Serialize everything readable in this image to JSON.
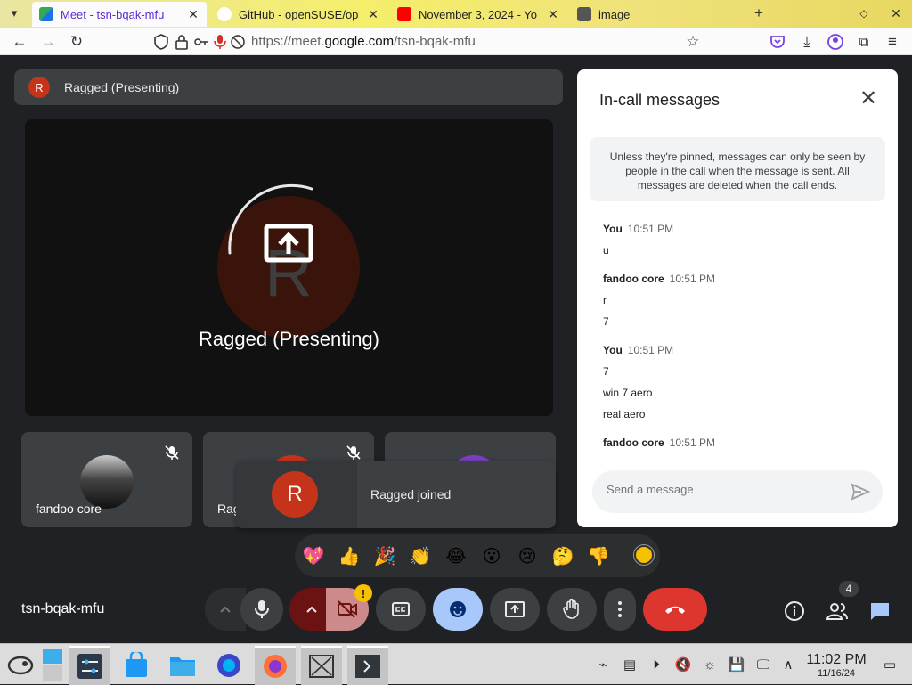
{
  "browser": {
    "tabs": [
      {
        "title": "Meet - tsn-bqak-mfu",
        "active": true,
        "favicon_color": "#1a73e8"
      },
      {
        "title": "GitHub - openSUSE/op",
        "active": false,
        "favicon_color": "#ffffff"
      },
      {
        "title": "November 3, 2024 - Yo",
        "active": false,
        "favicon_color": "#ff0000"
      },
      {
        "title": "image",
        "active": false,
        "favicon_color": "#555555"
      }
    ],
    "url_prefix": "https://meet.",
    "url_domain": "google.com",
    "url_path": "/tsn-bqak-mfu"
  },
  "meet": {
    "presenting_label": "Ragged (Presenting)",
    "presenting_initial": "R",
    "main_name": "Ragged (Presenting)",
    "main_initial": "R",
    "tiles": [
      {
        "name": "fandoo core"
      },
      {
        "name": "Rag"
      },
      {
        "name": ""
      }
    ],
    "toast": {
      "initial": "R",
      "message": "Ragged joined"
    },
    "meeting_code": "tsn-bqak-mfu",
    "participants_count": "4",
    "camera_alert": "!"
  },
  "chat": {
    "title": "In-call messages",
    "info": "Unless they're pinned, messages can only be seen by people in the call when the message is sent. All messages are deleted when the call ends.",
    "messages": [
      {
        "sender": "You",
        "time": "10:51 PM",
        "lines": [
          "u"
        ]
      },
      {
        "sender": "fandoo core",
        "time": "10:51 PM",
        "lines": [
          "r",
          "7"
        ]
      },
      {
        "sender": "You",
        "time": "10:51 PM",
        "lines": [
          "7",
          "win 7 aero",
          "real aero"
        ]
      },
      {
        "sender": "fandoo core",
        "time": "10:51 PM",
        "lines": []
      }
    ],
    "input_placeholder": "Send a message"
  },
  "reactions": [
    "💖",
    "👍",
    "🎉",
    "👏",
    "😂",
    "😮",
    "😢",
    "🤔",
    "👎"
  ],
  "taskbar": {
    "time": "11:02 PM",
    "date": "11/16/24"
  }
}
